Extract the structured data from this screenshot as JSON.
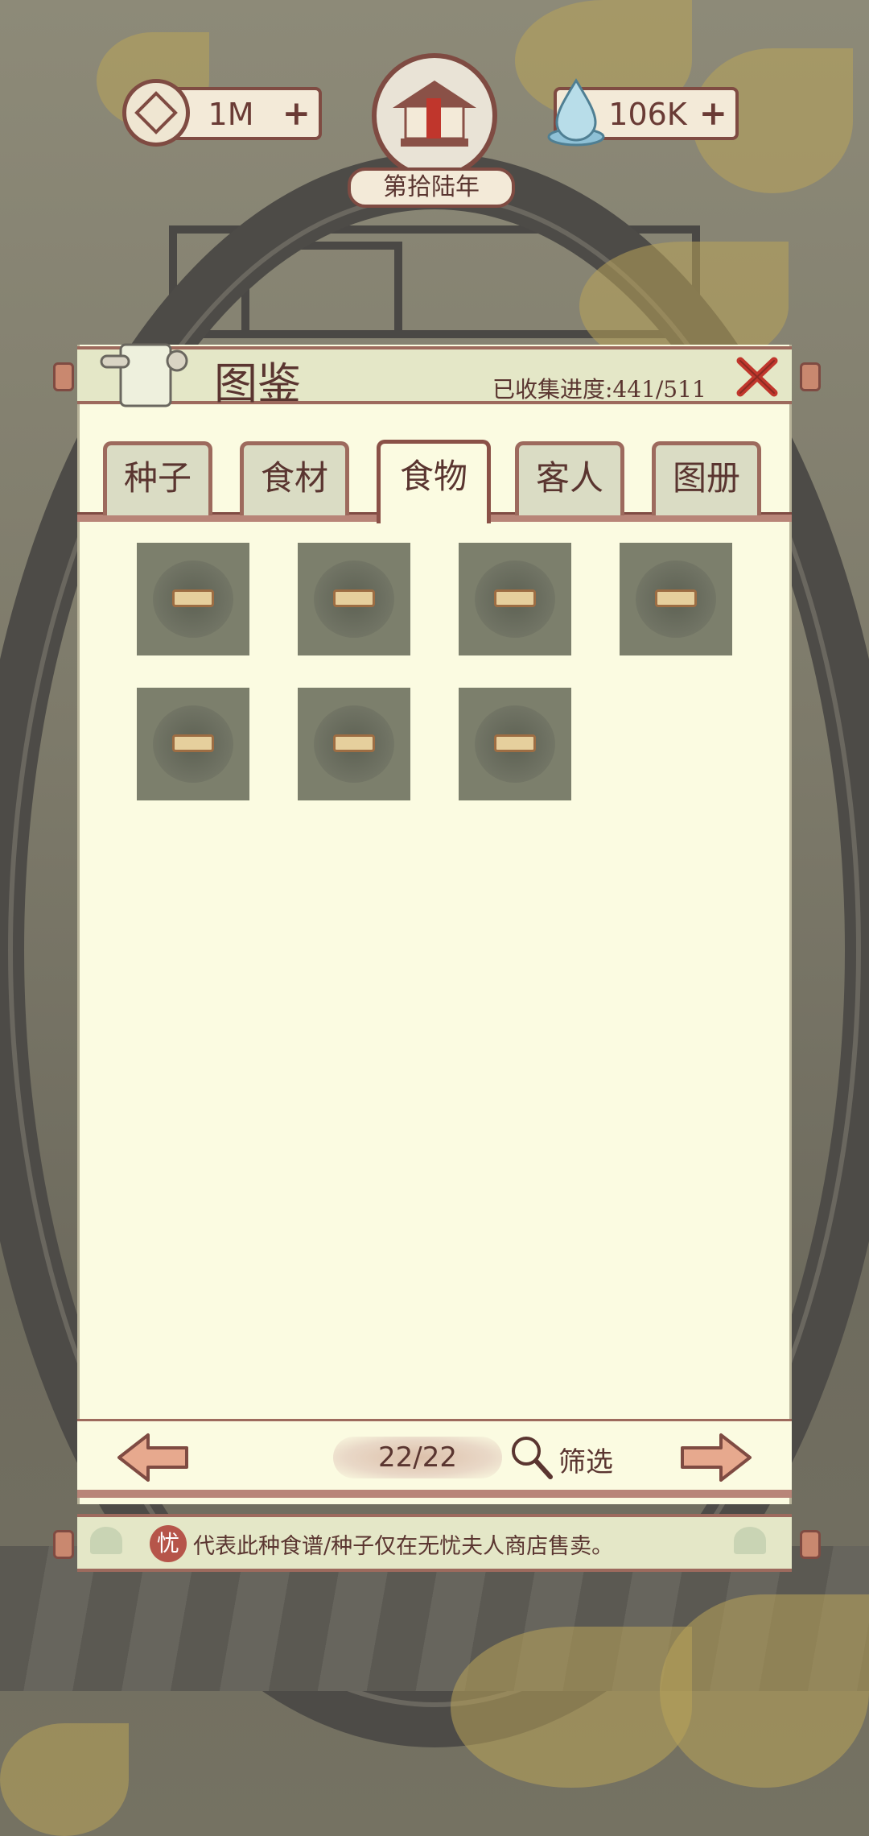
{
  "resources": {
    "coins": "1M",
    "water": "106K",
    "plus": "+"
  },
  "year_label": "第拾陆年",
  "panel": {
    "title": "图鉴",
    "progress": "已收集进度:441/511"
  },
  "tabs": [
    {
      "label": "种子",
      "active": false
    },
    {
      "label": "食材",
      "active": false
    },
    {
      "label": "食物",
      "active": true
    },
    {
      "label": "客人",
      "active": false
    },
    {
      "label": "图册",
      "active": false
    }
  ],
  "grid_item_count": 7,
  "pagination": {
    "page": "22/22",
    "filter_label": "筛选"
  },
  "note": {
    "badge": "忧",
    "text": "代表此种食谱/种子仅在无忧夫人商店售卖。"
  },
  "colors": {
    "panel_bg": "#fbfbe1",
    "accent_brown": "#7f4b42",
    "close_red": "#c0362c"
  }
}
